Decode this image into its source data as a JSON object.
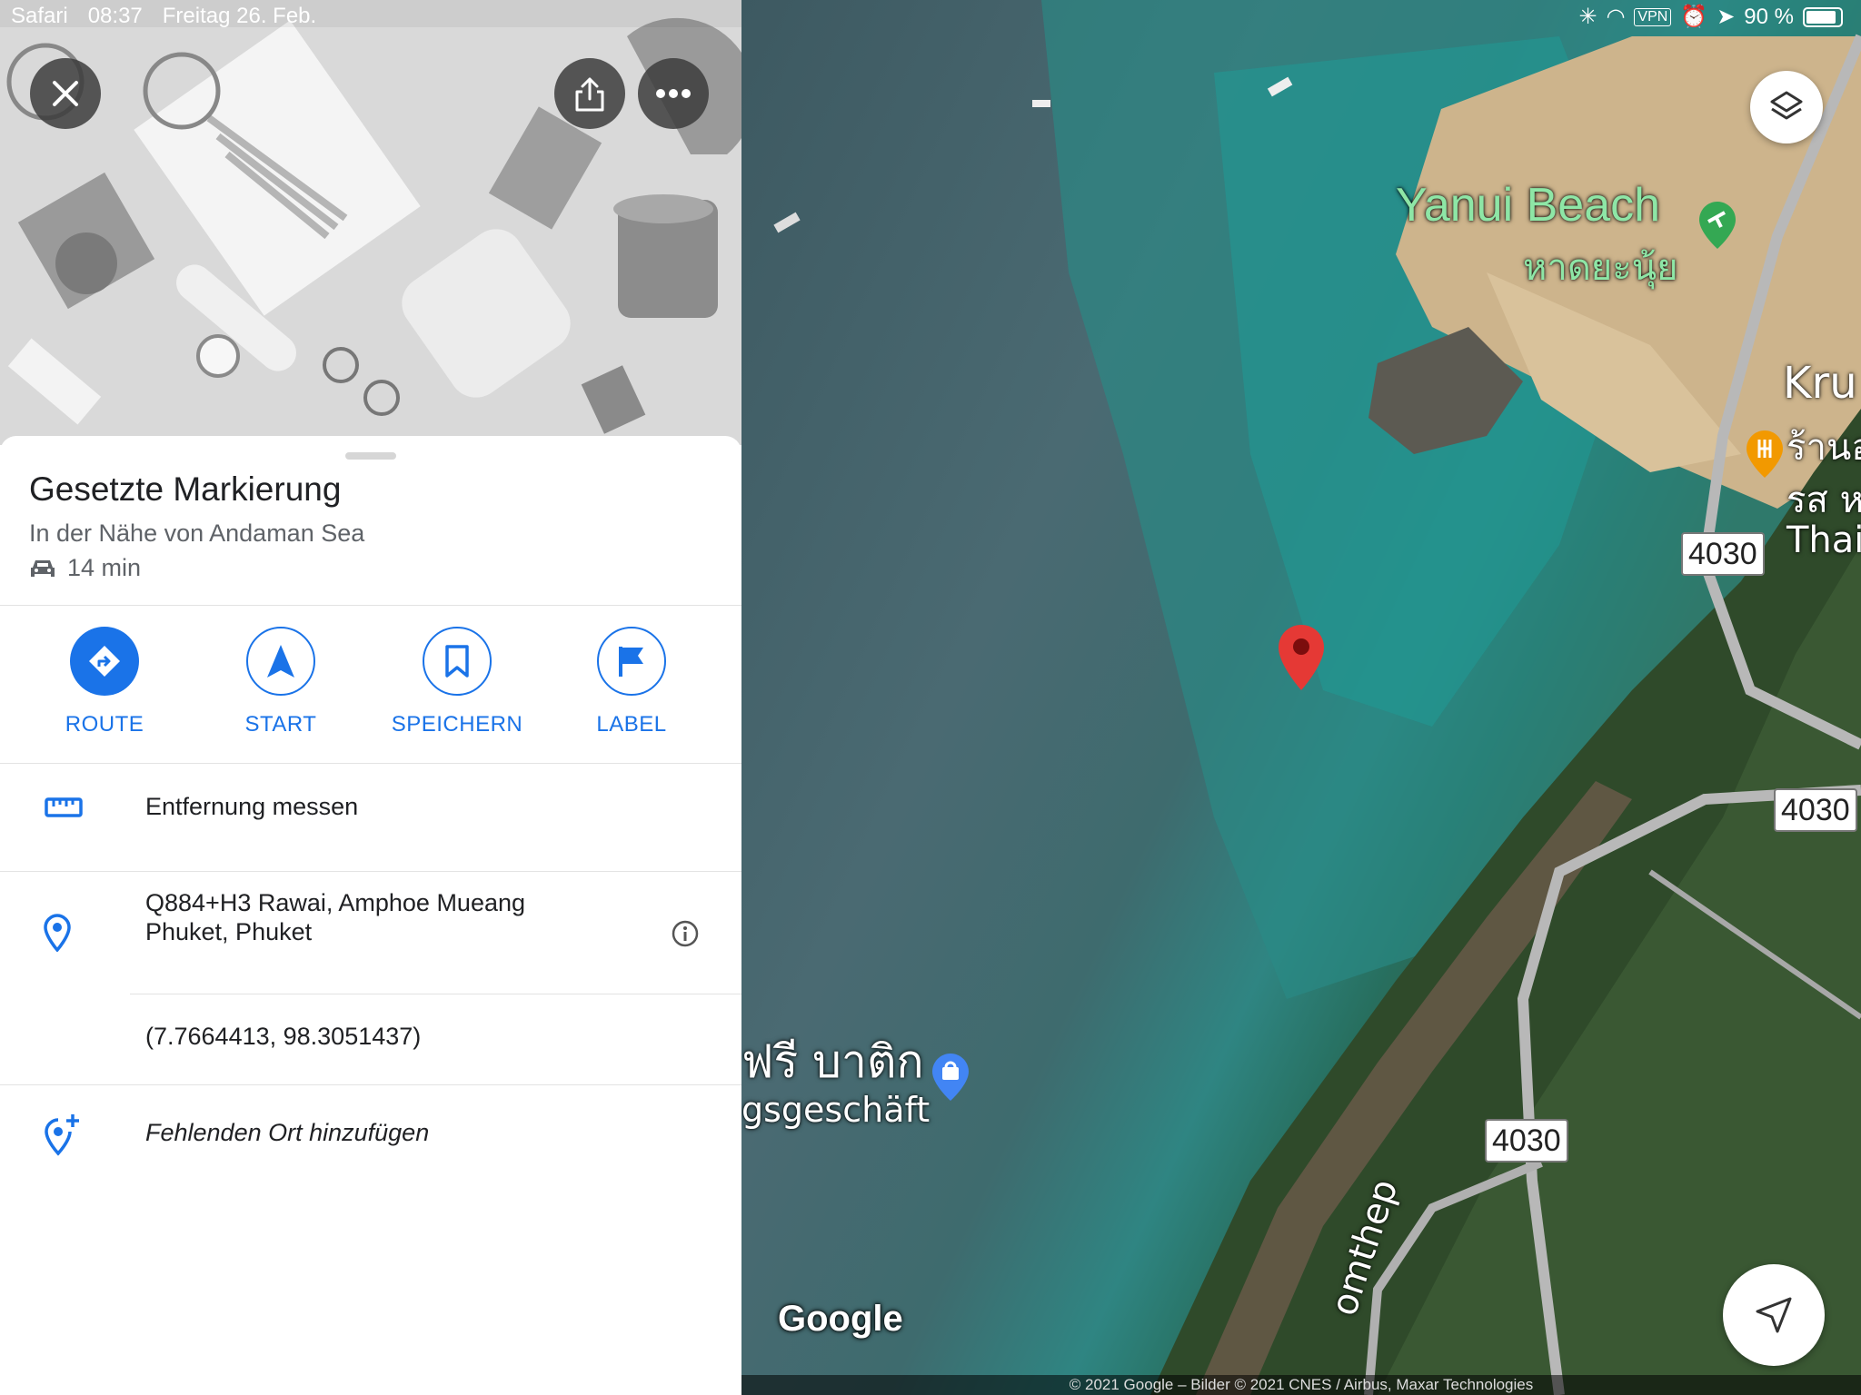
{
  "status_bar": {
    "back_app": "Safari",
    "time": "08:37",
    "date": "Freitag 26. Feb.",
    "vpn": "VPN",
    "battery": "90 %"
  },
  "place": {
    "title": "Gesetzte Markierung",
    "subtitle": "In der Nähe von Andaman Sea",
    "drive_time": "14 min"
  },
  "actions": [
    {
      "label": "ROUTE",
      "icon": "directions-icon"
    },
    {
      "label": "START",
      "icon": "navigation-arrow-icon"
    },
    {
      "label": "SPEICHERN",
      "icon": "bookmark-icon"
    },
    {
      "label": "LABEL",
      "icon": "flag-icon"
    }
  ],
  "rows": {
    "measure": "Entfernung messen",
    "address_line1": "Q884+H3 Rawai, Amphoe Mueang",
    "address_line2": "Phuket, Phuket",
    "coordinates": "(7.7664413, 98.3051437)",
    "add_place": "Fehlenden Ort hinzufügen"
  },
  "map": {
    "beach_name": "Yanui Beach",
    "beach_thai": "หาดยะนุ้ย",
    "poi_right_1": "Kru",
    "poi_right_2": "ร้านอ",
    "poi_right_3": "รส ห",
    "poi_right_4": "Thai",
    "shop_thai": "ฟรี บาติก",
    "shop_de": "gsgeschäft",
    "road_number": "4030",
    "road_name": "omthep",
    "google_logo": "Google",
    "copyright": "© 2021 Google – Bilder © 2021 CNES / Airbus, Maxar Technologies"
  },
  "colors": {
    "accent": "#1a73e8",
    "pin": "#e53935",
    "beach_label": "#8ee6a6"
  }
}
